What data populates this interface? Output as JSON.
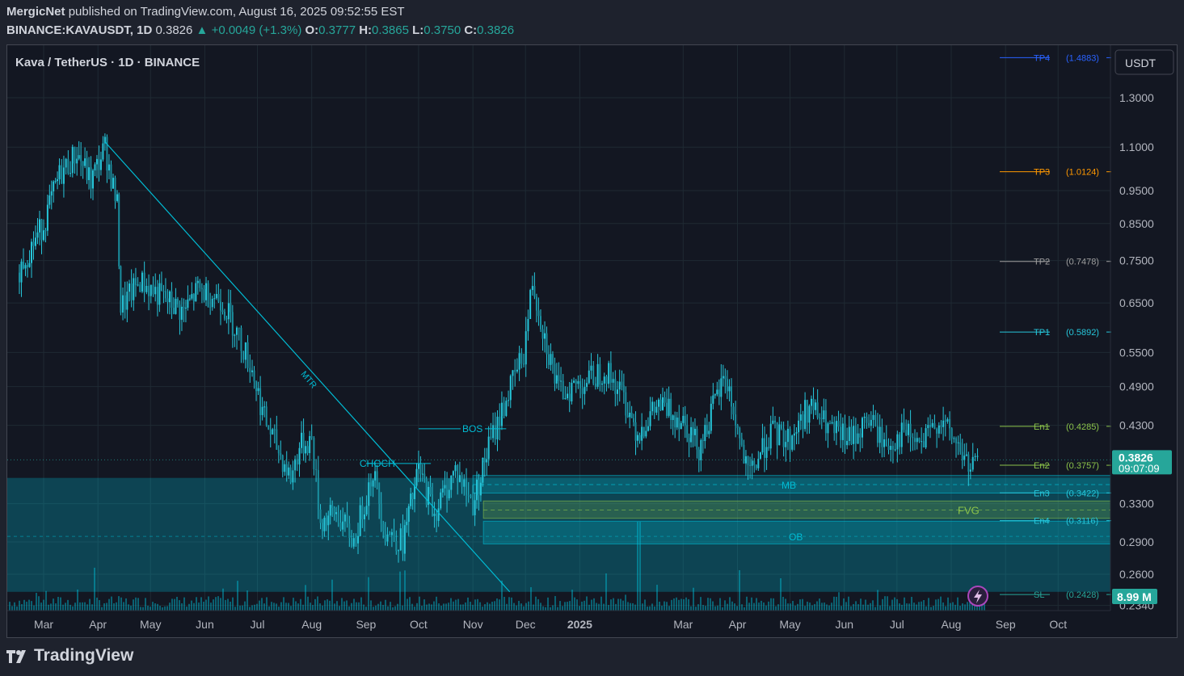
{
  "header": {
    "author": "MergicNet",
    "published_text": "published on TradingView.com, August 16, 2025 09:52:55 EST",
    "symbol": "BINANCE:KAVAUSDT, 1D",
    "last": "0.3826",
    "change": "+0.0049 (+1.3%)",
    "open_label": "O:",
    "open": "0.3777",
    "high_label": "H:",
    "high": "0.3865",
    "low_label": "L:",
    "low": "0.3750",
    "close_label": "C:",
    "close": "0.3826"
  },
  "chart_title": "Kava / TetherUS · 1D · BINANCE",
  "currency_button": "USDT",
  "footer_brand": "TradingView",
  "colors": {
    "background": "#131722",
    "up": "#26c6da",
    "zone": "#00bcd4",
    "fvg": "#8bc34a",
    "tp4": "#2962ff",
    "tp3": "#ff9800",
    "tp2": "#9e9e9e",
    "tp1": "#26c6da",
    "entry": "#8bc34a",
    "sl": "#26a69a"
  },
  "chart_data": {
    "type": "candlestick",
    "scale": "log",
    "y_ticks": [
      "1.3000",
      "1.1000",
      "0.9500",
      "0.8500",
      "0.7500",
      "0.6500",
      "0.5500",
      "0.4900",
      "0.4300",
      "0.3300",
      "0.2900",
      "0.2600",
      "0.2340"
    ],
    "x_ticks": [
      "Mar",
      "Apr",
      "May",
      "Jun",
      "Jul",
      "Aug",
      "Sep",
      "Oct",
      "Nov",
      "Dec",
      "2025",
      "Mar",
      "Apr",
      "May",
      "Jun",
      "Jul",
      "Aug",
      "Sep",
      "Oct"
    ],
    "x_range": [
      "2024-02-15",
      "2025-10-31"
    ],
    "last_price": "0.3826",
    "countdown": "09:07:09",
    "volume_label": "8.99 M",
    "levels": [
      {
        "label": "TP4",
        "value": "(1.4883)",
        "price": 1.4883,
        "color": "#2962ff"
      },
      {
        "label": "TP3",
        "value": "(1.0124)",
        "price": 1.0124,
        "color": "#ff9800"
      },
      {
        "label": "TP2",
        "value": "(0.7478)",
        "price": 0.7478,
        "color": "#9e9e9e"
      },
      {
        "label": "TP1",
        "value": "(0.5892)",
        "price": 0.5892,
        "color": "#26c6da"
      },
      {
        "label": "En1",
        "value": "(0.4285)",
        "price": 0.4285,
        "color": "#8bc34a"
      },
      {
        "label": "En2",
        "value": "(0.3757)",
        "price": 0.3757,
        "color": "#8bc34a"
      },
      {
        "label": "En3",
        "value": "(0.3422)",
        "price": 0.3422,
        "color": "#26c6da"
      },
      {
        "label": "En4",
        "value": "(0.3116)",
        "price": 0.3116,
        "color": "#26c6da"
      },
      {
        "label": "SL",
        "value": "(0.2428)",
        "price": 0.2428,
        "color": "#26a69a"
      }
    ],
    "annotations": [
      "MTR",
      "CHOCH",
      "BOS",
      "MB",
      "FVG",
      "OB"
    ],
    "price_path": [
      [
        "2024-02-15",
        0.72
      ],
      [
        "2024-03-01",
        0.85
      ],
      [
        "2024-03-10",
        1.0
      ],
      [
        "2024-03-20",
        1.08
      ],
      [
        "2024-03-28",
        0.98
      ],
      [
        "2024-04-05",
        1.1
      ],
      [
        "2024-04-12",
        0.9
      ],
      [
        "2024-04-14",
        0.64
      ],
      [
        "2024-04-25",
        0.7
      ],
      [
        "2024-05-05",
        0.67
      ],
      [
        "2024-05-20",
        0.63
      ],
      [
        "2024-05-28",
        0.68
      ],
      [
        "2024-06-10",
        0.66
      ],
      [
        "2024-06-18",
        0.6
      ],
      [
        "2024-06-28",
        0.52
      ],
      [
        "2024-07-05",
        0.44
      ],
      [
        "2024-07-12",
        0.4
      ],
      [
        "2024-07-20",
        0.36
      ],
      [
        "2024-07-25",
        0.4
      ],
      [
        "2024-08-01",
        0.41
      ],
      [
        "2024-08-06",
        0.31
      ],
      [
        "2024-08-15",
        0.32
      ],
      [
        "2024-08-25",
        0.29
      ],
      [
        "2024-09-05",
        0.37
      ],
      [
        "2024-09-12",
        0.3
      ],
      [
        "2024-09-22",
        0.29
      ],
      [
        "2024-10-01",
        0.37
      ],
      [
        "2024-10-10",
        0.32
      ],
      [
        "2024-10-22",
        0.37
      ],
      [
        "2024-11-01",
        0.33
      ],
      [
        "2024-11-10",
        0.4
      ],
      [
        "2024-11-20",
        0.47
      ],
      [
        "2024-11-30",
        0.55
      ],
      [
        "2024-12-05",
        0.7
      ],
      [
        "2024-12-12",
        0.58
      ],
      [
        "2024-12-20",
        0.48
      ],
      [
        "2025-01-05",
        0.5
      ],
      [
        "2025-01-15",
        0.52
      ],
      [
        "2025-01-25",
        0.48
      ],
      [
        "2025-02-03",
        0.42
      ],
      [
        "2025-02-15",
        0.46
      ],
      [
        "2025-03-01",
        0.44
      ],
      [
        "2025-03-10",
        0.4
      ],
      [
        "2025-03-25",
        0.51
      ],
      [
        "2025-04-07",
        0.36
      ],
      [
        "2025-04-20",
        0.42
      ],
      [
        "2025-05-01",
        0.41
      ],
      [
        "2025-05-12",
        0.46
      ],
      [
        "2025-05-25",
        0.42
      ],
      [
        "2025-06-05",
        0.41
      ],
      [
        "2025-06-15",
        0.44
      ],
      [
        "2025-06-25",
        0.4
      ],
      [
        "2025-07-05",
        0.42
      ],
      [
        "2025-07-15",
        0.4
      ],
      [
        "2025-07-25",
        0.44
      ],
      [
        "2025-08-05",
        0.4
      ],
      [
        "2025-08-12",
        0.37
      ],
      [
        "2025-08-16",
        0.3826
      ]
    ]
  }
}
